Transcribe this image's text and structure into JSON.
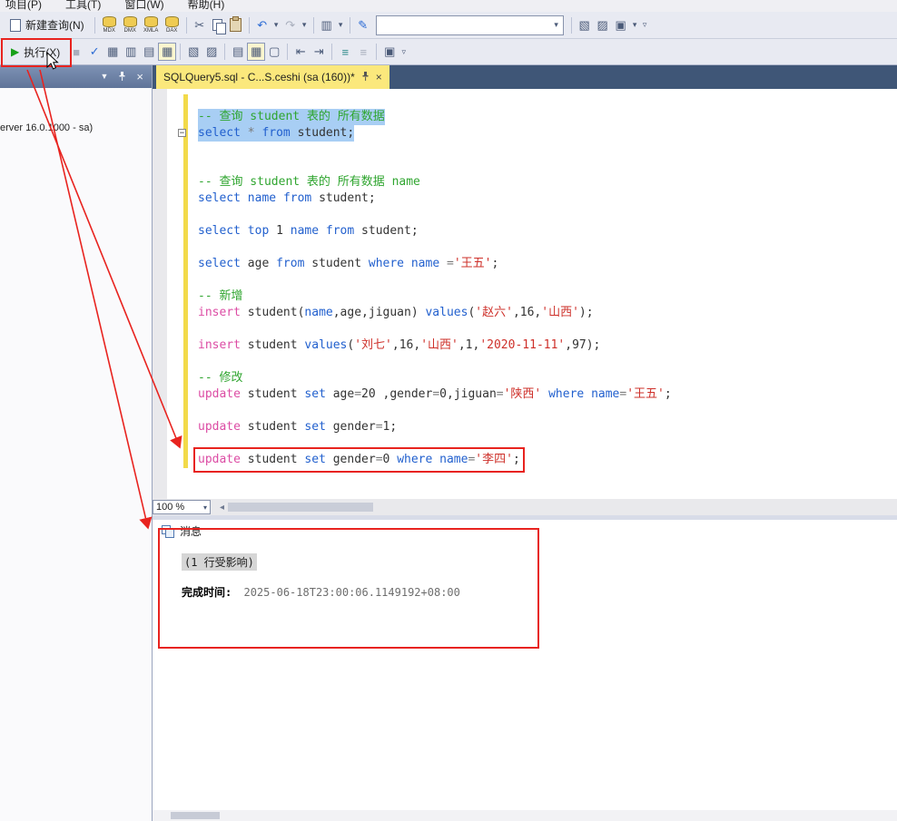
{
  "menu": {
    "items": [
      "项目(P)",
      "工具(T)",
      "窗口(W)",
      "帮助(H)"
    ]
  },
  "toolbar_main": {
    "new_query_label": "新建查询(N)",
    "db_icon_labels": [
      "MDX",
      "DMX",
      "XMLA",
      "DAX"
    ]
  },
  "toolbar_query": {
    "execute_label": "执行(X)"
  },
  "icons": {
    "cut": "✂",
    "undo": "↶",
    "redo": "↷",
    "caret_down": "▾",
    "overflow": "▿",
    "script": "▥",
    "pen": "✎",
    "doc_arrow": "▧",
    "wrench": "▨",
    "window": "▣",
    "execute_play": "▶",
    "stop": "■",
    "parse_check": "✓",
    "est_plan": "▦",
    "live_stats": "▥",
    "query_options": "▤",
    "results_grid": "▦",
    "template_params": "▧",
    "design_query": "▨",
    "results_text": "▤",
    "results_file": "▢",
    "indent": "⇥",
    "outdent": "⇤",
    "comment": "≡",
    "uncomment": "≡",
    "sqlcmd": "▣",
    "scroll_left": "◂",
    "oe_dropdown": "▼",
    "close": "×",
    "fold_minus": "−"
  },
  "document_tab": {
    "title": "SQLQuery5.sql - C...S.ceshi (sa (160))*"
  },
  "object_explorer": {
    "visible_text": "erver 16.0.1000 - sa)"
  },
  "editor": {
    "zoom": "100 %",
    "lines": [
      {
        "sel": true,
        "tokens": [
          [
            "-- 查询 student 表的 所有数据",
            "cm"
          ]
        ]
      },
      {
        "sel": true,
        "fold": true,
        "tokens": [
          [
            "select ",
            "kw"
          ],
          [
            "* ",
            "op"
          ],
          [
            "from ",
            "kw"
          ],
          [
            "student;",
            "id"
          ]
        ]
      },
      {
        "tokens": []
      },
      {
        "tokens": []
      },
      {
        "tokens": [
          [
            "-- 查询 student 表的 所有数据 name",
            "cm"
          ]
        ]
      },
      {
        "tokens": [
          [
            "select ",
            "kw"
          ],
          [
            "name ",
            "kw"
          ],
          [
            "from ",
            "kw"
          ],
          [
            "student;",
            "id"
          ]
        ]
      },
      {
        "tokens": []
      },
      {
        "tokens": [
          [
            "select ",
            "kw"
          ],
          [
            "top ",
            "kw"
          ],
          [
            "1 ",
            "num"
          ],
          [
            "name ",
            "kw"
          ],
          [
            "from ",
            "kw"
          ],
          [
            "student;",
            "id"
          ]
        ]
      },
      {
        "tokens": []
      },
      {
        "tokens": [
          [
            "select ",
            "kw"
          ],
          [
            "age ",
            "id"
          ],
          [
            "from ",
            "kw"
          ],
          [
            "student ",
            "id"
          ],
          [
            "where ",
            "kw"
          ],
          [
            "name ",
            "kw"
          ],
          [
            "=",
            "op"
          ],
          [
            "'王五'",
            "str"
          ],
          [
            ";",
            "id"
          ]
        ]
      },
      {
        "tokens": []
      },
      {
        "tokens": [
          [
            "-- 新增",
            "cm"
          ]
        ]
      },
      {
        "tokens": [
          [
            "insert ",
            "dml"
          ],
          [
            "student(",
            "id"
          ],
          [
            "name",
            "kw"
          ],
          [
            ",age,jiguan) ",
            "id"
          ],
          [
            "values",
            "kw"
          ],
          [
            "(",
            "id"
          ],
          [
            "'赵六'",
            "str"
          ],
          [
            ",16,",
            "id"
          ],
          [
            "'山西'",
            "str"
          ],
          [
            ");",
            "id"
          ]
        ]
      },
      {
        "tokens": []
      },
      {
        "tokens": [
          [
            "insert ",
            "dml"
          ],
          [
            "student ",
            "id"
          ],
          [
            "values",
            "kw"
          ],
          [
            "(",
            "id"
          ],
          [
            "'刘七'",
            "str"
          ],
          [
            ",16,",
            "id"
          ],
          [
            "'山西'",
            "str"
          ],
          [
            ",1,",
            "id"
          ],
          [
            "'2020-11-11'",
            "str"
          ],
          [
            ",97);",
            "id"
          ]
        ]
      },
      {
        "tokens": []
      },
      {
        "tokens": [
          [
            "-- 修改",
            "cm"
          ]
        ]
      },
      {
        "tokens": [
          [
            "update ",
            "dml"
          ],
          [
            "student ",
            "id"
          ],
          [
            "set ",
            "kw"
          ],
          [
            "age",
            "id"
          ],
          [
            "=",
            "op"
          ],
          [
            "20 ",
            "num"
          ],
          [
            ",gender",
            "id"
          ],
          [
            "=",
            "op"
          ],
          [
            "0,",
            "id"
          ],
          [
            "jiguan",
            "id"
          ],
          [
            "=",
            "op"
          ],
          [
            "'陕西' ",
            "str"
          ],
          [
            "where ",
            "kw"
          ],
          [
            "name",
            "kw"
          ],
          [
            "=",
            "op"
          ],
          [
            "'王五'",
            "str"
          ],
          [
            ";",
            "id"
          ]
        ]
      },
      {
        "tokens": []
      },
      {
        "tokens": [
          [
            "update ",
            "dml"
          ],
          [
            "student ",
            "id"
          ],
          [
            "set ",
            "kw"
          ],
          [
            "gender",
            "id"
          ],
          [
            "=",
            "op"
          ],
          [
            "1;",
            "id"
          ]
        ]
      },
      {
        "tokens": []
      },
      {
        "boxed": true,
        "tokens": [
          [
            "update ",
            "dml"
          ],
          [
            "student ",
            "id"
          ],
          [
            "set ",
            "kw"
          ],
          [
            "gender",
            "id"
          ],
          [
            "=",
            "op"
          ],
          [
            "0 ",
            "num"
          ],
          [
            "where ",
            "kw"
          ],
          [
            "name",
            "kw"
          ],
          [
            "=",
            "op"
          ],
          [
            "'李四'",
            "str"
          ],
          [
            ";",
            "id"
          ]
        ]
      }
    ]
  },
  "results": {
    "tab_label": "消息",
    "rows_affected": "(1 行受影响)",
    "completion_label": "完成时间:",
    "completion_time": "2025-06-18T23:00:06.1149192+08:00"
  },
  "annotation_color": "#E8231F"
}
